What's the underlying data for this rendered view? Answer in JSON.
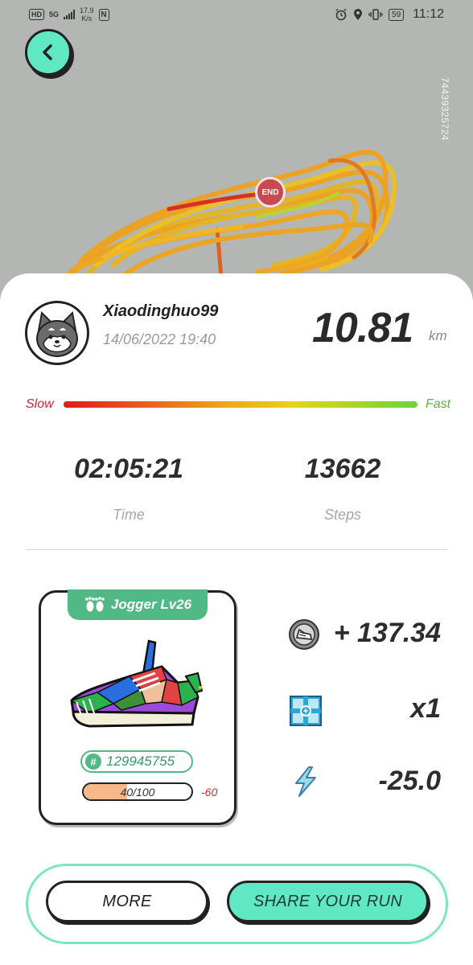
{
  "status_bar": {
    "network_speed_value": "17.9",
    "network_speed_unit": "K/s",
    "hd_badge": "HD",
    "network_type": "5G",
    "nfc_label": "N",
    "battery": "59",
    "time": "11:12"
  },
  "map": {
    "record_id": "7443932572​4",
    "end_label": "END"
  },
  "run": {
    "username": "Xiaodinghuo99",
    "datetime": "14/06/2022 19:40",
    "distance": "10.81",
    "distance_unit": "km",
    "speed_slow_label": "Slow",
    "speed_fast_label": "Fast",
    "time_value": "02:05:21",
    "time_label": "Time",
    "steps_value": "13662",
    "steps_label": "Steps"
  },
  "shoe": {
    "tag": "Jogger Lv26",
    "id_symbol": "#",
    "id": "129945755",
    "durability_text": "40/100",
    "durability_fraction": 0.4,
    "durability_change": "-60"
  },
  "rewards": {
    "token_value": "+ 137.34",
    "multiplier_value": "x1",
    "energy_value": "-25.0"
  },
  "buttons": {
    "more": "MORE",
    "share": "SHARE YOUR RUN"
  },
  "colors": {
    "accent_mint": "#5fe8c3",
    "shoe_green": "#51b985",
    "slow_red": "#d0262b",
    "fast_green": "#5db336"
  },
  "icons": [
    "back-arrow-icon",
    "sneaker-token-icon",
    "mystery-box-icon",
    "lightning-energy-icon",
    "footprints-icon"
  ]
}
